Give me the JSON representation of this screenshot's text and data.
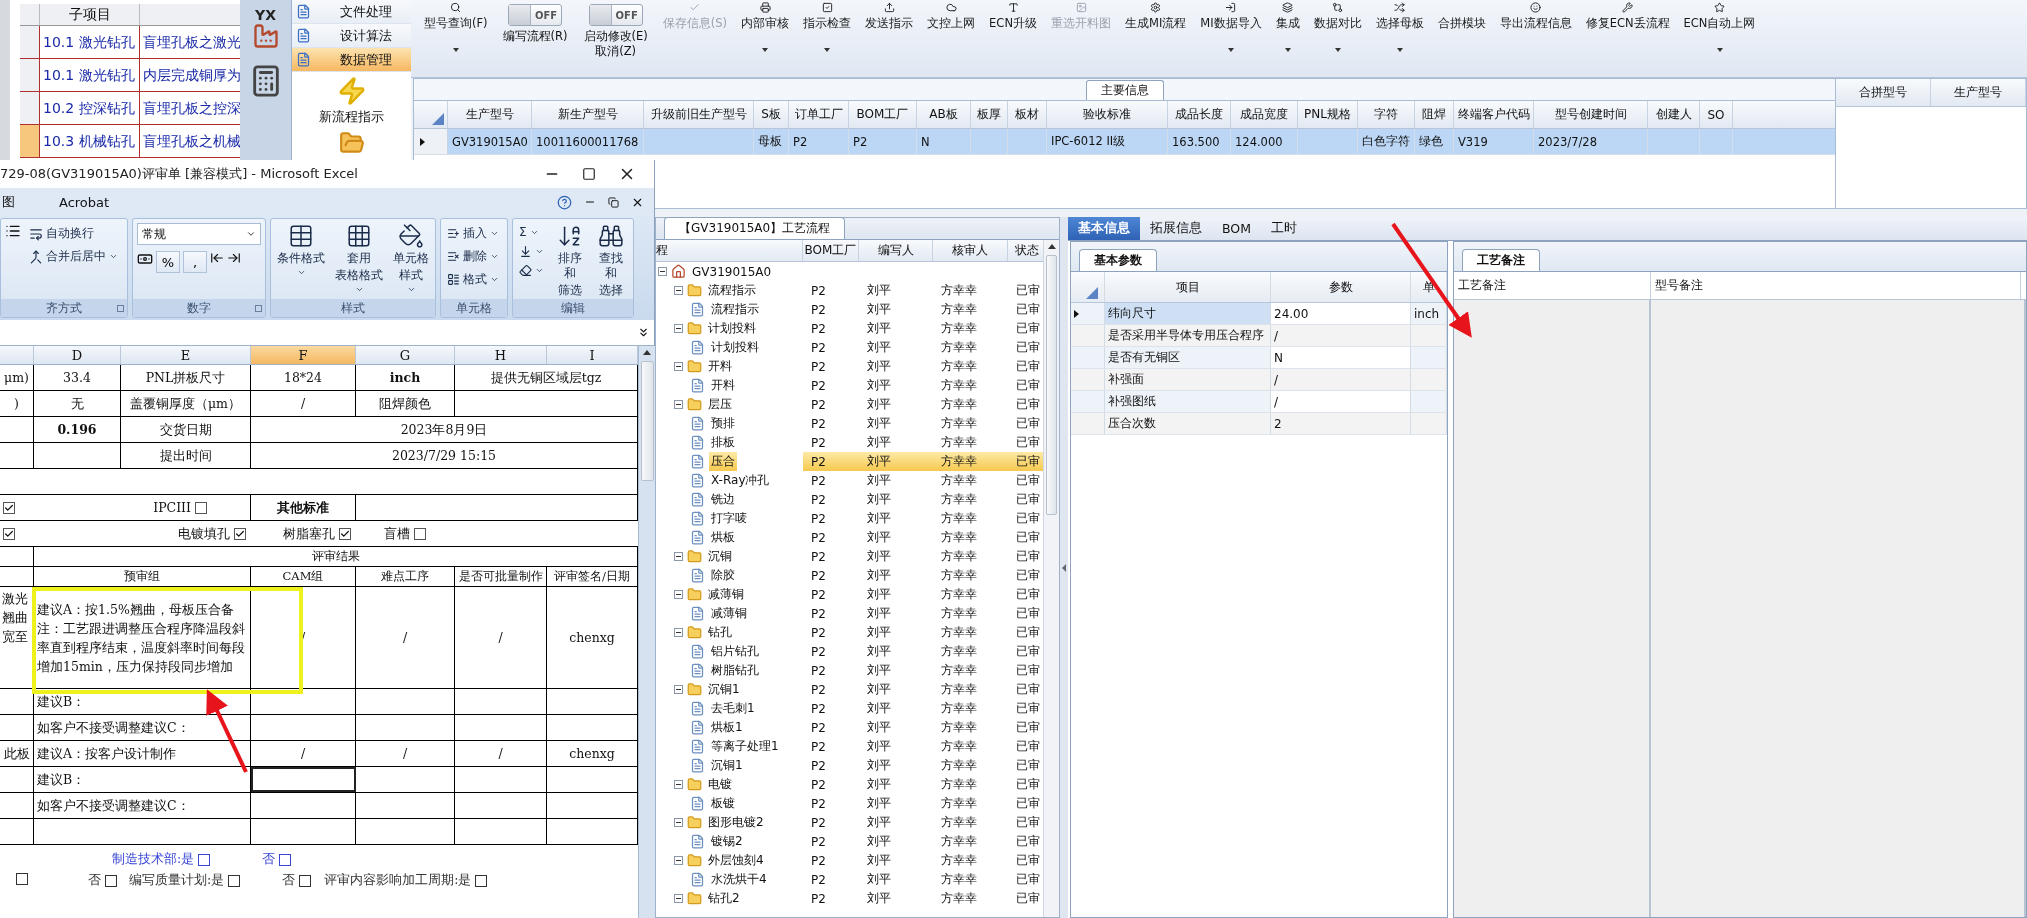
{
  "subitems": {
    "header": "子项目",
    "rows": [
      {
        "code": "10.1 激光钻孔",
        "desc": "盲埋孔板之激光",
        "selected": false
      },
      {
        "code": "10.1 激光钻孔",
        "desc": "内层完成铜厚为",
        "selected": false
      },
      {
        "code": "10.2 控深钻孔",
        "desc": "盲埋孔板之控深",
        "selected": false
      },
      {
        "code": "10.3 机械钻孔",
        "desc": "盲埋孔板之机械",
        "selected": true
      }
    ]
  },
  "nav": {
    "logo_text": "YX"
  },
  "menu": {
    "items": [
      {
        "label": "文件处理",
        "selected": false
      },
      {
        "label": "设计算法",
        "selected": false
      },
      {
        "label": "数据管理",
        "selected": true
      }
    ],
    "action": "新流程指示"
  },
  "toolbar": {
    "buttons": [
      {
        "kind": "button",
        "label": "型号查询(F)",
        "dropdown": true,
        "disabled": false
      },
      {
        "kind": "toggle",
        "label": [
          "编写流程(R)"
        ],
        "switch_text": "OFF",
        "on": false
      },
      {
        "kind": "toggle",
        "label": [
          "启动修改(E)",
          "取消(Z)"
        ],
        "switch_text": "OFF",
        "on": false
      },
      {
        "kind": "button",
        "label": "保存信息(S)",
        "dropdown": false,
        "disabled": true
      },
      {
        "kind": "button",
        "label": "内部审核",
        "dropdown": true,
        "disabled": false
      },
      {
        "kind": "button",
        "label": "指示检查",
        "dropdown": true,
        "disabled": false
      },
      {
        "kind": "button",
        "label": "发送指示",
        "dropdown": false,
        "disabled": false
      },
      {
        "kind": "button",
        "label": "文控上网",
        "dropdown": false,
        "disabled": false
      },
      {
        "kind": "button",
        "label": "ECN升级",
        "dropdown": false,
        "disabled": false
      },
      {
        "kind": "button",
        "label": "重选开料图",
        "dropdown": false,
        "disabled": true
      },
      {
        "kind": "button",
        "label": "生成MI流程",
        "dropdown": false,
        "disabled": false
      },
      {
        "kind": "button",
        "label": "MI数据导入",
        "dropdown": true,
        "disabled": false
      },
      {
        "kind": "button",
        "label": "集成",
        "dropdown": true,
        "disabled": false
      },
      {
        "kind": "button",
        "label": "数据对比",
        "dropdown": true,
        "disabled": false
      },
      {
        "kind": "button",
        "label": "选择母板",
        "dropdown": true,
        "disabled": false
      },
      {
        "kind": "button",
        "label": "合拼模块",
        "dropdown": false,
        "disabled": false
      },
      {
        "kind": "button",
        "label": "导出流程信息",
        "dropdown": false,
        "disabled": false
      },
      {
        "kind": "button",
        "label": "修复ECN丢流程",
        "dropdown": false,
        "disabled": false
      },
      {
        "kind": "button",
        "label": "ECN自动上网",
        "dropdown": true,
        "disabled": false
      }
    ]
  },
  "main_info": {
    "title": "主要信息",
    "columns": [
      "生产型号",
      "新生产型号",
      "升级前旧生产型号",
      "S板",
      "订单工厂",
      "BOM工厂",
      "AB板",
      "板厚",
      "板材",
      "验收标准",
      "成品长度",
      "成品宽度",
      "PNL规格",
      "字符",
      "阻焊",
      "终端客户代码",
      "型号创建时间",
      "创建人",
      "SO"
    ],
    "rows": [
      {
        "selected": true,
        "cells": [
          "GV319015A0",
          "10011600011768",
          null,
          "母板",
          "P2",
          "P2",
          "N",
          null,
          null,
          "IPC-6012 II级",
          "163.500",
          "124.000",
          null,
          "白色字符",
          "绿色",
          "V319",
          "2023/7/28",
          null,
          null
        ]
      }
    ],
    "side_columns": [
      "合拼型号",
      "生产型号"
    ]
  },
  "process": {
    "tab": "【GV319015A0】工艺流程",
    "columns": [
      "程",
      "BOM工厂",
      "编写人",
      "核审人",
      "状态"
    ],
    "root": {
      "name": "GV319015A0",
      "expanded": true,
      "children": [
        {
          "name": "流程指示",
          "factory": "P2",
          "writer": "刘平",
          "reviewer": "方幸幸",
          "status": "已审",
          "expanded": true,
          "selected": false,
          "children": [
            {
              "name": "流程指示",
              "factory": "P2",
              "writer": "刘平",
              "reviewer": "方幸幸",
              "status": "已审",
              "selected": false
            }
          ]
        },
        {
          "name": "计划投料",
          "factory": "P2",
          "writer": "刘平",
          "reviewer": "方幸幸",
          "status": "已审",
          "expanded": true,
          "selected": false,
          "children": [
            {
              "name": "计划投料",
              "factory": "P2",
              "writer": "刘平",
              "reviewer": "方幸幸",
              "status": "已审",
              "selected": false
            }
          ]
        },
        {
          "name": "开料",
          "factory": "P2",
          "writer": "刘平",
          "reviewer": "方幸幸",
          "status": "已审",
          "expanded": true,
          "selected": false,
          "children": [
            {
              "name": "开料",
              "factory": "P2",
              "writer": "刘平",
              "reviewer": "方幸幸",
              "status": "已审",
              "selected": false
            }
          ]
        },
        {
          "name": "层压",
          "factory": "P2",
          "writer": "刘平",
          "reviewer": "方幸幸",
          "status": "已审",
          "expanded": true,
          "selected": false,
          "children": [
            {
              "name": "预排",
              "factory": "P2",
              "writer": "刘平",
              "reviewer": "方幸幸",
              "status": "已审",
              "selected": false
            },
            {
              "name": "排板",
              "factory": "P2",
              "writer": "刘平",
              "reviewer": "方幸幸",
              "status": "已审",
              "selected": false
            },
            {
              "name": "压合",
              "factory": "P2",
              "writer": "刘平",
              "reviewer": "方幸幸",
              "status": "已审",
              "selected": true
            },
            {
              "name": "X-Ray冲孔",
              "factory": "P2",
              "writer": "刘平",
              "reviewer": "方幸幸",
              "status": "已审",
              "selected": false
            },
            {
              "name": "铣边",
              "factory": "P2",
              "writer": "刘平",
              "reviewer": "方幸幸",
              "status": "已审",
              "selected": false
            },
            {
              "name": "打字唛",
              "factory": "P2",
              "writer": "刘平",
              "reviewer": "方幸幸",
              "status": "已审",
              "selected": false
            },
            {
              "name": "烘板",
              "factory": "P2",
              "writer": "刘平",
              "reviewer": "方幸幸",
              "status": "已审",
              "selected": false
            }
          ]
        },
        {
          "name": "沉铜",
          "factory": "P2",
          "writer": "刘平",
          "reviewer": "方幸幸",
          "status": "已审",
          "expanded": true,
          "selected": false,
          "children": [
            {
              "name": "除胶",
              "factory": "P2",
              "writer": "刘平",
              "reviewer": "方幸幸",
              "status": "已审",
              "selected": false
            }
          ]
        },
        {
          "name": "减薄铜",
          "factory": "P2",
          "writer": "刘平",
          "reviewer": "方幸幸",
          "status": "已审",
          "expanded": true,
          "selected": false,
          "children": [
            {
              "name": "减薄铜",
              "factory": "P2",
              "writer": "刘平",
              "reviewer": "方幸幸",
              "status": "已审",
              "selected": false
            }
          ]
        },
        {
          "name": "钻孔",
          "factory": "P2",
          "writer": "刘平",
          "reviewer": "方幸幸",
          "status": "已审",
          "expanded": true,
          "selected": false,
          "children": [
            {
              "name": "铝片钻孔",
              "factory": "P2",
              "writer": "刘平",
              "reviewer": "方幸幸",
              "status": "已审",
              "selected": false
            },
            {
              "name": "树脂钻孔",
              "factory": "P2",
              "writer": "刘平",
              "reviewer": "方幸幸",
              "status": "已审",
              "selected": false
            }
          ]
        },
        {
          "name": "沉铜1",
          "factory": "P2",
          "writer": "刘平",
          "reviewer": "方幸幸",
          "status": "已审",
          "expanded": true,
          "selected": false,
          "children": [
            {
              "name": "去毛刺1",
              "factory": "P2",
              "writer": "刘平",
              "reviewer": "方幸幸",
              "status": "已审",
              "selected": false
            },
            {
              "name": "烘板1",
              "factory": "P2",
              "writer": "刘平",
              "reviewer": "方幸幸",
              "status": "已审",
              "selected": false
            },
            {
              "name": "等离子处理1",
              "factory": "P2",
              "writer": "刘平",
              "reviewer": "方幸幸",
              "status": "已审",
              "selected": false
            },
            {
              "name": "沉铜1",
              "factory": "P2",
              "writer": "刘平",
              "reviewer": "方幸幸",
              "status": "已审",
              "selected": false
            }
          ]
        },
        {
          "name": "电镀",
          "factory": "P2",
          "writer": "刘平",
          "reviewer": "方幸幸",
          "status": "已审",
          "expanded": true,
          "selected": false,
          "children": [
            {
              "name": "板镀",
              "factory": "P2",
              "writer": "刘平",
              "reviewer": "方幸幸",
              "status": "已审",
              "selected": false
            }
          ]
        },
        {
          "name": "图形电镀2",
          "factory": "P2",
          "writer": "刘平",
          "reviewer": "方幸幸",
          "status": "已审",
          "expanded": true,
          "selected": false,
          "children": [
            {
              "name": "镀锡2",
              "factory": "P2",
              "writer": "刘平",
              "reviewer": "方幸幸",
              "status": "已审",
              "selected": false
            }
          ]
        },
        {
          "name": "外层蚀刻4",
          "factory": "P2",
          "writer": "刘平",
          "reviewer": "方幸幸",
          "status": "已审",
          "expanded": true,
          "selected": false,
          "children": [
            {
              "name": "水洗烘干4",
              "factory": "P2",
              "writer": "刘平",
              "reviewer": "方幸幸",
              "status": "已审",
              "selected": false
            }
          ]
        },
        {
          "name": "钻孔2",
          "factory": "P2",
          "writer": "刘平",
          "reviewer": "方幸幸",
          "status": "已审",
          "expanded": true,
          "selected": false
        }
      ]
    }
  },
  "detail": {
    "tabs": [
      {
        "label": "基本信息",
        "selected": true
      },
      {
        "label": "拓展信息",
        "selected": false
      },
      {
        "label": "BOM",
        "selected": false
      },
      {
        "label": "工时",
        "selected": false
      }
    ],
    "params": {
      "tab": "基本参数",
      "columns": [
        "项目",
        "参数",
        "单"
      ],
      "rows": [
        {
          "item": "纬向尺寸",
          "value": "24.00",
          "unit": "inch",
          "selected": true
        },
        {
          "item": "是否采用半导体专用压合程序",
          "value": "/",
          "selected": false
        },
        {
          "item": "是否有无铜区",
          "value": "N",
          "selected": false
        },
        {
          "item": "补强面",
          "value": "/",
          "selected": false
        },
        {
          "item": "补强图纸",
          "value": "/",
          "selected": false
        },
        {
          "item": "压合次数",
          "value": "2",
          "selected": false
        }
      ]
    },
    "remarks": {
      "tab": "工艺备注",
      "columns": [
        "工艺备注",
        "型号备注"
      ]
    }
  },
  "excel": {
    "title": "729-08(GV319015A0)评审单  [兼容模式]  -  Microsoft Excel",
    "tabs": [
      "图",
      "Acrobat"
    ],
    "ribbon": [
      {
        "kind": "align",
        "title": "齐方式",
        "items": [
          "自动换行",
          "合并后居中"
        ]
      },
      {
        "kind": "number",
        "title": "数字",
        "format": "常规",
        "symbols": [
          "%",
          ","
        ]
      },
      {
        "kind": "large",
        "title": "样式",
        "items": [
          [
            "条件格式"
          ],
          [
            "套用",
            "表格格式"
          ],
          [
            "单元格",
            "样式"
          ]
        ]
      },
      {
        "kind": "small",
        "title": "单元格",
        "items": [
          "插入",
          "删除",
          "格式"
        ]
      },
      {
        "kind": "edit",
        "title": "编辑",
        "sum": "Σ",
        "items": [
          [
            "排序和",
            "筛选"
          ],
          [
            "查找和",
            "选择"
          ]
        ]
      }
    ],
    "columns": [
      {
        "selected": false
      },
      {
        "label": "D",
        "selected": false
      },
      {
        "label": "E",
        "selected": false
      },
      {
        "label": "F",
        "selected": true
      },
      {
        "label": "G",
        "selected": false
      },
      {
        "label": "H",
        "selected": false
      },
      {
        "label": "I",
        "selected": false
      }
    ],
    "rows": [
      {
        "kind": "grid",
        "cells": [
          {
            "text": "μm)"
          },
          {
            "text": "33.4"
          },
          {
            "text": "PNL拼板尺寸"
          },
          {
            "text": "18*24"
          },
          {
            "text": "inch",
            "strong": true
          },
          {
            "text": "提供无铜区域层tgz"
          }
        ]
      },
      {
        "kind": "grid",
        "cells": [
          {
            "text": ")"
          },
          {
            "text": "无"
          },
          {
            "text": "盖覆铜厚度（μm）"
          },
          {
            "text": "/"
          },
          {
            "text": "阻焊颜色"
          },
          null
        ]
      },
      {
        "kind": "grid",
        "cells": [
          null,
          {
            "text": "0.196",
            "strong": true
          },
          {
            "text": "交货日期"
          },
          {
            "text": "2023年8月9日"
          }
        ]
      },
      {
        "kind": "grid",
        "cells": [
          null,
          null,
          {
            "text": "提出时间"
          },
          {
            "text": "2023/7/29 15:15"
          }
        ]
      },
      {
        "kind": "grid",
        "cells": [
          null
        ]
      },
      {
        "kind": "grid",
        "cells": [
          {
            "checks": [
              {
                "checked": true
              },
              {
                "label": "IPCIII",
                "checked": false
              }
            ]
          },
          {
            "text": "其他标准",
            "strong": true
          },
          null
        ]
      },
      {
        "kind": "open",
        "cells": [
          {
            "checks": [
              {
                "checked": true
              }
            ]
          },
          {
            "checks": [
              {
                "label": "电镀填孔",
                "checked": true
              }
            ]
          },
          {
            "checks": [
              {
                "label": "树脂塞孔",
                "checked": true
              }
            ]
          },
          {
            "checks": [
              {
                "label": "盲槽",
                "checked": false
              }
            ]
          },
          null
        ]
      },
      {
        "kind": "head",
        "cells": [
          null,
          {
            "text": "评审结果"
          }
        ]
      },
      {
        "kind": "head",
        "cells": [
          null,
          {
            "text": "预审组"
          },
          {
            "text": "CAM组"
          },
          {
            "text": "难点工序"
          },
          {
            "text": "是否可批量制作"
          },
          {
            "text": "评审签名/日期"
          }
        ]
      },
      {
        "kind": "tall",
        "cells": [
          {
            "text": "激光翘曲宽至"
          },
          {
            "text": "建议A：按1.5%翘曲，母板压合备注：工艺跟进调整压合程序降温段斜率直到程序结束，温度斜率时间每段增加15min，压力保持段同步增加"
          },
          {
            "text": "/"
          },
          {
            "text": "/"
          },
          {
            "text": "/"
          },
          {
            "text": "chenxg"
          }
        ]
      },
      {
        "kind": "suggestion",
        "cells": [
          null,
          {
            "text": "建议B："
          },
          null,
          null,
          null,
          null
        ]
      },
      {
        "kind": "suggestion",
        "cells": [
          null,
          {
            "text": "如客户不接受调整建议C："
          },
          null,
          null,
          null,
          null
        ]
      },
      {
        "kind": "suggestion",
        "cells": [
          {
            "text": "此板"
          },
          {
            "text": "建议A：按客户设计制作"
          },
          {
            "text": "/"
          },
          {
            "text": "/"
          },
          {
            "text": "/"
          },
          {
            "text": "chenxg"
          }
        ]
      },
      {
        "kind": "suggestion",
        "cells": [
          null,
          {
            "text": "建议B："
          },
          {
            "selected": true
          },
          null,
          null,
          null
        ]
      },
      {
        "kind": "suggestion",
        "cells": [
          null,
          {
            "text": "如客户不接受调整建议C："
          },
          null,
          null,
          null,
          null
        ]
      },
      {
        "kind": "grid",
        "cells": [
          null,
          null,
          null,
          null,
          null,
          null
        ]
      }
    ],
    "footer": [
      [
        {
          "label": "制造技术部:是",
          "checked": false,
          "color": "#3a46d6"
        },
        {
          "label": "否",
          "checked": false,
          "color": "#3a46d6"
        }
      ],
      [
        {
          "checked": false,
          "color": "#333333"
        },
        {
          "label": "否",
          "checked": false,
          "color": "#333333"
        },
        {
          "label": "编写质量计划:是",
          "checked": false,
          "color": "#333333"
        },
        {
          "label": "否",
          "checked": false,
          "color": "#333333"
        },
        {
          "label": "评审内容影响加工周期:是",
          "checked": false,
          "color": "#333333"
        }
      ]
    ]
  }
}
